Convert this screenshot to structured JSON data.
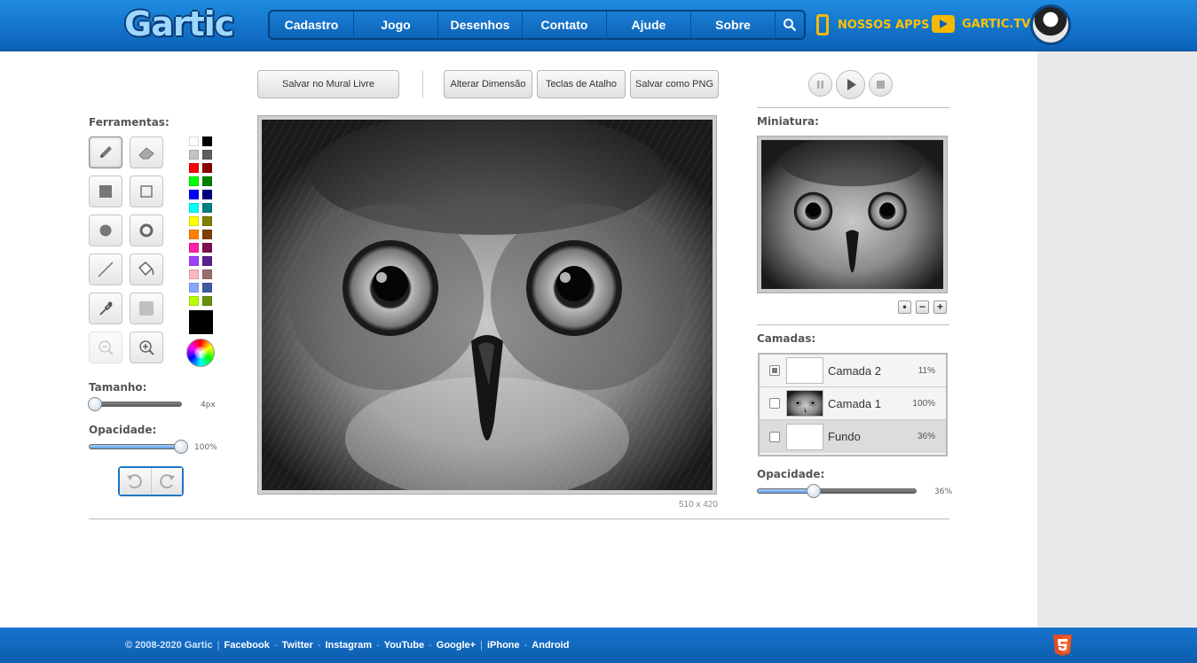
{
  "header": {
    "logo": "Gartic",
    "nav": [
      "Cadastro",
      "Jogo",
      "Desenhos",
      "Contato",
      "Ajude",
      "Sobre"
    ],
    "apps_label": "NOSSOS APPS",
    "tv_label": "GARTIC.TV"
  },
  "toolbar": {
    "save_mural": "Salvar no Mural Livre",
    "change_dim": "Alterar Dimensão",
    "shortcuts": "Teclas de Atalho",
    "save_png": "Salvar como PNG"
  },
  "left": {
    "tools_label": "Ferramentas:",
    "size_label": "Tamanho:",
    "size_value": "4px",
    "size_fraction": 0.04,
    "opacity_label": "Opacidade:",
    "opacity_value": "100%",
    "opacity_fraction": 1.0
  },
  "palette": {
    "colors": [
      "#ffffff",
      "#000000",
      "#c3c3c3",
      "#5f5f5f",
      "#ff0000",
      "#8b0000",
      "#00ff00",
      "#007f00",
      "#0000ff",
      "#00007f",
      "#00ffff",
      "#007f7f",
      "#ffff00",
      "#7f7f00",
      "#ff8000",
      "#7f4000",
      "#ff1fa5",
      "#7f1050",
      "#a040ff",
      "#5a2090",
      "#ffb6c1",
      "#9b6f6f",
      "#87a7ff",
      "#3f5aa0",
      "#b8ff00",
      "#6a8f10"
    ],
    "current": "#000000"
  },
  "canvas": {
    "dimensions": "510 x 420"
  },
  "right": {
    "thumb_label": "Miniatura:",
    "layers_label": "Camadas:",
    "opacity_label": "Opacidade:",
    "opacity_value": "36%",
    "opacity_fraction": 0.36,
    "layers": [
      {
        "name": "Camada 2",
        "percent": "11%",
        "visible": true,
        "selected": false
      },
      {
        "name": "Camada 1",
        "percent": "100%",
        "visible": false,
        "selected": false
      },
      {
        "name": "Fundo",
        "percent": "36%",
        "visible": false,
        "selected": true
      }
    ]
  },
  "footer": {
    "copyright": "© 2008-2020 Gartic",
    "links": [
      "Facebook",
      "Twitter",
      "Instagram",
      "YouTube",
      "Google+"
    ],
    "apps": [
      "iPhone",
      "Android"
    ]
  },
  "colors": {
    "header_blue": "#0a62b8",
    "accent_yellow": "#f7b900",
    "slider_fill": "#5a9ae0"
  }
}
